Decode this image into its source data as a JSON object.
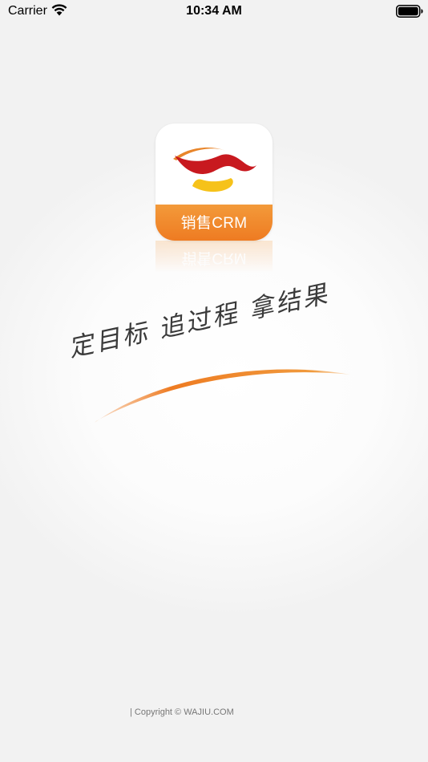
{
  "status_bar": {
    "carrier": "Carrier",
    "time": "10:34 AM",
    "icons": [
      "wifi-icon",
      "battery-icon"
    ]
  },
  "logo": {
    "label": "销售CRM",
    "colors": {
      "band_top": "#f39a3a",
      "band_bottom": "#ee7b22",
      "ribbon_red": "#c8191f",
      "ribbon_orange": "#e8852a",
      "ribbon_yellow": "#f6c21a"
    }
  },
  "slogan": {
    "text": "定目标 追过程 拿结果",
    "swoosh_color": "#ee7b22"
  },
  "footer": {
    "copyright": "| Copyright © WAJIU.COM"
  }
}
